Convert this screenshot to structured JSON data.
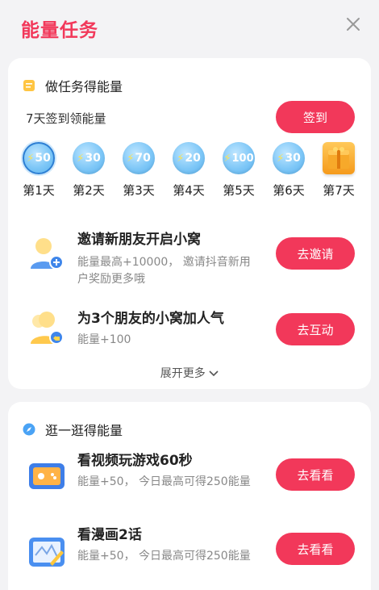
{
  "header": {
    "title": "能量任务"
  },
  "energy_tasks": {
    "section_title": "做任务得能量",
    "signin": {
      "label": "7天签到领能量",
      "button": "签到",
      "days": [
        {
          "value": "50",
          "label": "第1天",
          "active": true
        },
        {
          "value": "30",
          "label": "第2天"
        },
        {
          "value": "70",
          "label": "第3天"
        },
        {
          "value": "20",
          "label": "第4天"
        },
        {
          "value": "100",
          "label": "第5天"
        },
        {
          "value": "30",
          "label": "第6天"
        },
        {
          "value": "",
          "label": "第7天",
          "icon": "gift-box-icon"
        }
      ]
    },
    "tasks": [
      {
        "title": "邀请新朋友开启小窝",
        "desc": "能量最高+10000， 邀请抖音新用户奖励更多哦",
        "button": "去邀请",
        "icon": "invite-friend-icon"
      },
      {
        "title": "为3个朋友的小窝加人气",
        "desc": "能量+100",
        "button": "去互动",
        "icon": "friends-like-icon"
      }
    ],
    "more": "展开更多"
  },
  "browse": {
    "section_title": "逛一逛得能量",
    "tasks": [
      {
        "title": "看视频玩游戏60秒",
        "desc": "能量+50， 今日最高可得250能量",
        "button": "去看看",
        "icon": "game-video-icon"
      },
      {
        "title": "看漫画2话",
        "desc": "能量+50， 今日最高可得250能量",
        "button": "去看看",
        "icon": "comic-icon"
      }
    ]
  },
  "colors": {
    "accent": "#f2385a",
    "coin": "#7ec7f7"
  }
}
